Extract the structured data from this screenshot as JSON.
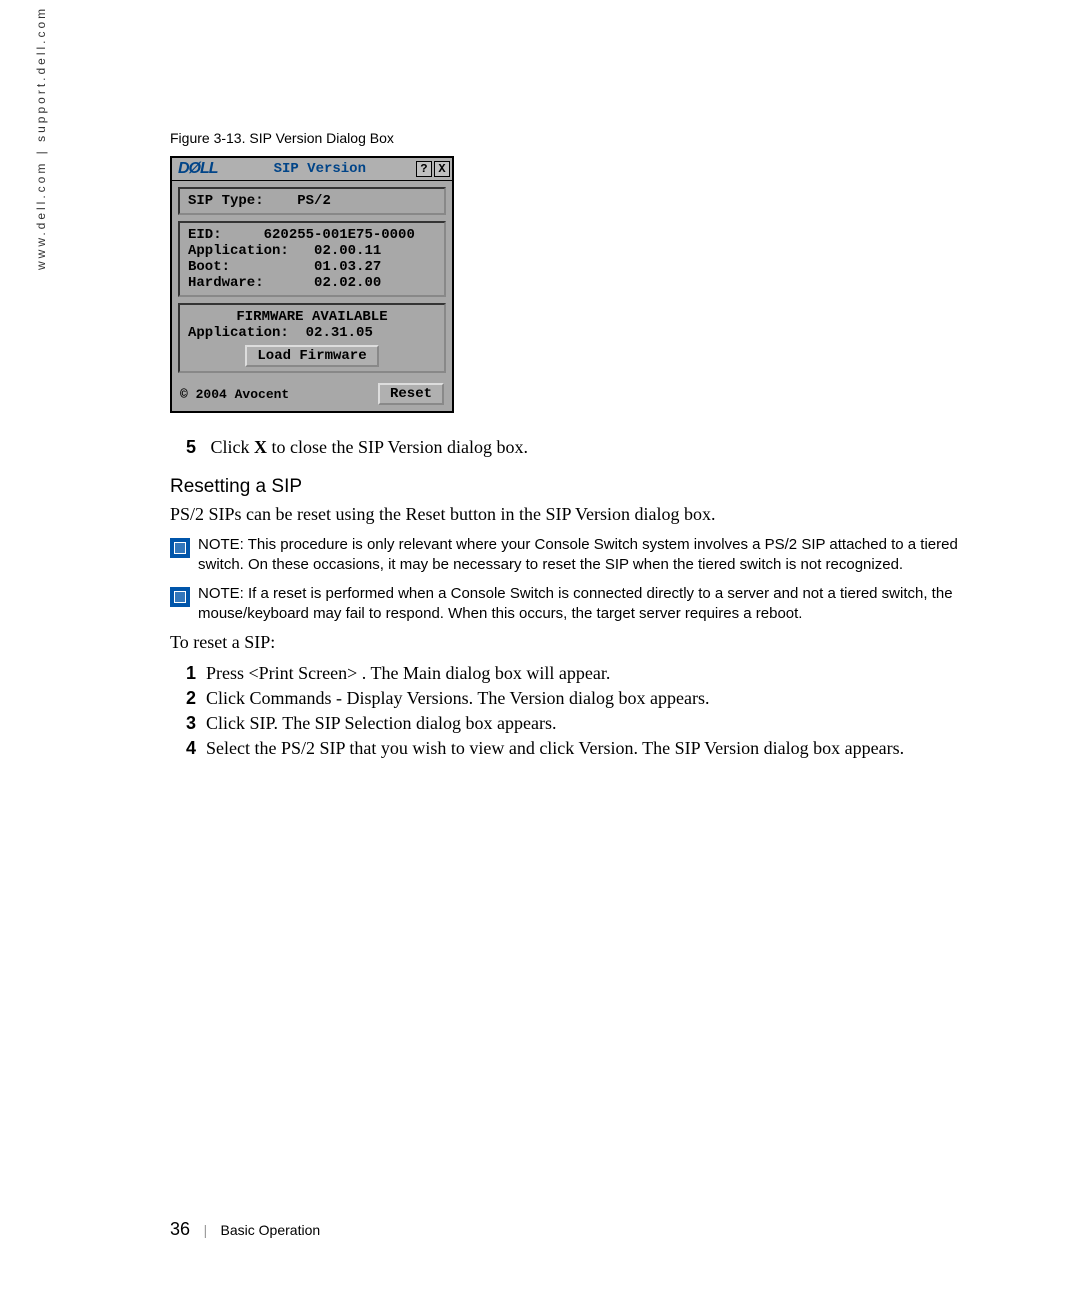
{
  "side_url": "www.dell.com | support.dell.com",
  "figure_caption": "Figure 3-13.    SIP Version Dialog Box",
  "dialog": {
    "logo": "DØLL",
    "title": "SIP Version",
    "help_btn": "?",
    "close_btn": "X",
    "sip_type_label": "SIP Type:",
    "sip_type_value": "PS/2",
    "eid_label": "EID:",
    "eid_value": "620255-001E75-0000",
    "app_label": "Application:",
    "app_value": "02.00.11",
    "boot_label": "Boot:",
    "boot_value": "01.03.27",
    "hw_label": "Hardware:",
    "hw_value": "02.02.00",
    "fw_header": "FIRMWARE AVAILABLE",
    "fw_app_label": "Application:",
    "fw_app_value": "02.31.05",
    "load_btn": "Load Firmware",
    "copyright": "© 2004 Avocent",
    "reset_btn": "Reset"
  },
  "step5_num": "5",
  "step5_pre": "Click ",
  "step5_bold": "X",
  "step5_post": " to close the SIP Version dialog box.",
  "section_head": "Resetting a SIP",
  "intro": "PS/2 SIPs can be reset using the Reset button in the SIP Version dialog box.",
  "note1_label": "NOTE: ",
  "note1_body": "This procedure is only relevant where your Console Switch system involves a PS/2 SIP attached to a tiered switch. On these occasions, it may be necessary to reset the SIP when the tiered switch is not recognized.",
  "note2_label": "NOTE: ",
  "note2_body": "If a reset is performed when a Console Switch is connected directly to a server and not a tiered switch, the mouse/keyboard may fail to respond. When this occurs, the target server requires a reboot.",
  "to_reset": "To reset a SIP:",
  "steps": [
    {
      "n": "1",
      "t": "Press <Print Screen> . The Main dialog box will appear."
    },
    {
      "n": "2",
      "t": "Click Commands - Display Versions. The Version dialog box appears."
    },
    {
      "n": "3",
      "t": "Click SIP. The SIP Selection dialog box appears."
    },
    {
      "n": "4",
      "t": "Select the PS/2 SIP that you wish to view and click Version. The SIP Version dialog box appears."
    }
  ],
  "page_num": "36",
  "page_section": "Basic Operation"
}
